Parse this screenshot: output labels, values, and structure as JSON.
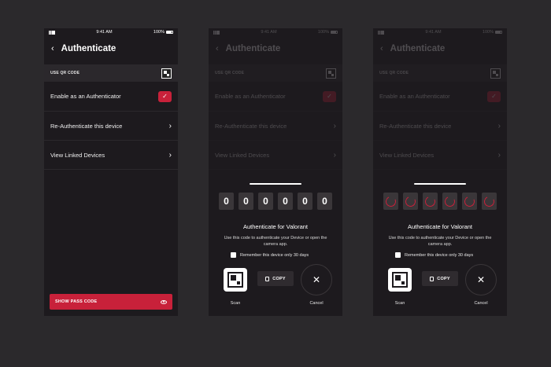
{
  "status": {
    "time": "9:41 AM",
    "battery": "100%"
  },
  "nav": {
    "title": "Authenticate"
  },
  "qr": {
    "label": "USE QR CODE"
  },
  "rows": {
    "enable": "Enable as an Authenticator",
    "reauth": "Re-Authenticate this device",
    "linked": "View Linked Devices"
  },
  "pass_button": {
    "label": "SHOW PASS CODE"
  },
  "sheet": {
    "digits": [
      "0",
      "0",
      "0",
      "0",
      "0",
      "0"
    ],
    "title": "Authenticate for Valorant",
    "description": "Use this code to authenticate your Device or open the camera app.",
    "remember": "Remember this device only 30 days",
    "scan_label": "Scan",
    "copy_label": "COPY",
    "cancel_label": "Cancel"
  },
  "colors": {
    "accent": "#c8213a",
    "background": "#2b292c",
    "panel": "#1d1a1e"
  },
  "icons": {
    "back": "back-chevron-icon",
    "qr": "qr-code-icon",
    "check": "check-icon",
    "chevron": "chevron-right-icon",
    "eye": "eye-icon",
    "copy": "copy-icon",
    "close": "close-icon",
    "spinner": "loading-spinner-icon"
  }
}
